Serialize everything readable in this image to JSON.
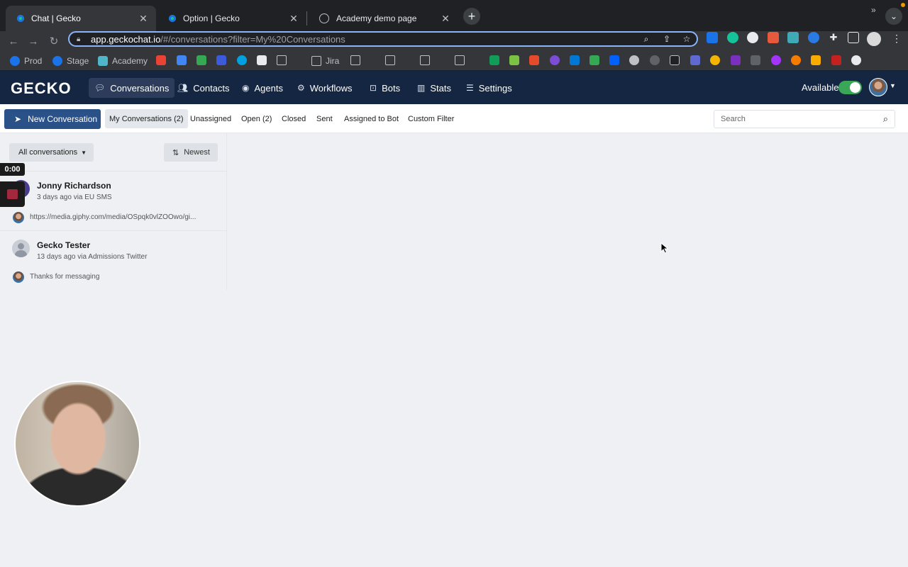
{
  "browser": {
    "tabs": [
      {
        "title": "Chat | Gecko",
        "active": true
      },
      {
        "title": "Option | Gecko",
        "active": false
      },
      {
        "title": "Academy demo page",
        "active": false
      }
    ],
    "url_host": "app.geckochat.io",
    "url_path": "/#/conversations?filter=My%20Conversations",
    "bookmarks": [
      {
        "label": "Prod"
      },
      {
        "label": "Stage"
      },
      {
        "label": "Academy"
      },
      {
        "label": "Jira"
      }
    ]
  },
  "appnav": {
    "logo": "GECKO",
    "items": [
      {
        "label": "Conversations",
        "icon": "chat-icon",
        "active": true
      },
      {
        "label": "Contacts",
        "icon": "people-icon",
        "active": false
      },
      {
        "label": "Agents",
        "icon": "user-circle-icon",
        "active": false
      },
      {
        "label": "Workflows",
        "icon": "workflow-icon",
        "active": false
      },
      {
        "label": "Bots",
        "icon": "bot-icon",
        "active": false
      },
      {
        "label": "Stats",
        "icon": "bar-chart-icon",
        "active": false
      },
      {
        "label": "Settings",
        "icon": "sliders-icon",
        "active": false
      }
    ],
    "availability_label": "Available",
    "available": true
  },
  "filterbar": {
    "new_conversation": "New Conversation",
    "tabs": [
      {
        "label": "My Conversations (2)",
        "active": true
      },
      {
        "label": "Unassigned",
        "active": false
      },
      {
        "label": "Open (2)",
        "active": false
      },
      {
        "label": "Closed",
        "active": false
      },
      {
        "label": "Sent",
        "active": false
      },
      {
        "label": "Assigned to Bot",
        "active": false
      },
      {
        "label": "Custom Filter",
        "active": false
      }
    ],
    "search_placeholder": "Search"
  },
  "list": {
    "dropdown_label": "All conversations",
    "sort_label": "Newest",
    "conversations": [
      {
        "name": "Jonny Richardson",
        "meta": "3 days ago via EU SMS",
        "preview": "https://media.giphy.com/media/OSpqk0vlZOOwo/gi..."
      },
      {
        "name": "Gecko Tester",
        "meta": "13 days ago via Admissions Twitter",
        "preview": "Thanks for messaging"
      }
    ]
  },
  "recording": {
    "timer": "0:00"
  },
  "colors": {
    "nav_bg": "#152642",
    "primary_button": "#2a5289",
    "toggle_on": "#3aa657",
    "stop_red": "#a3283e"
  }
}
